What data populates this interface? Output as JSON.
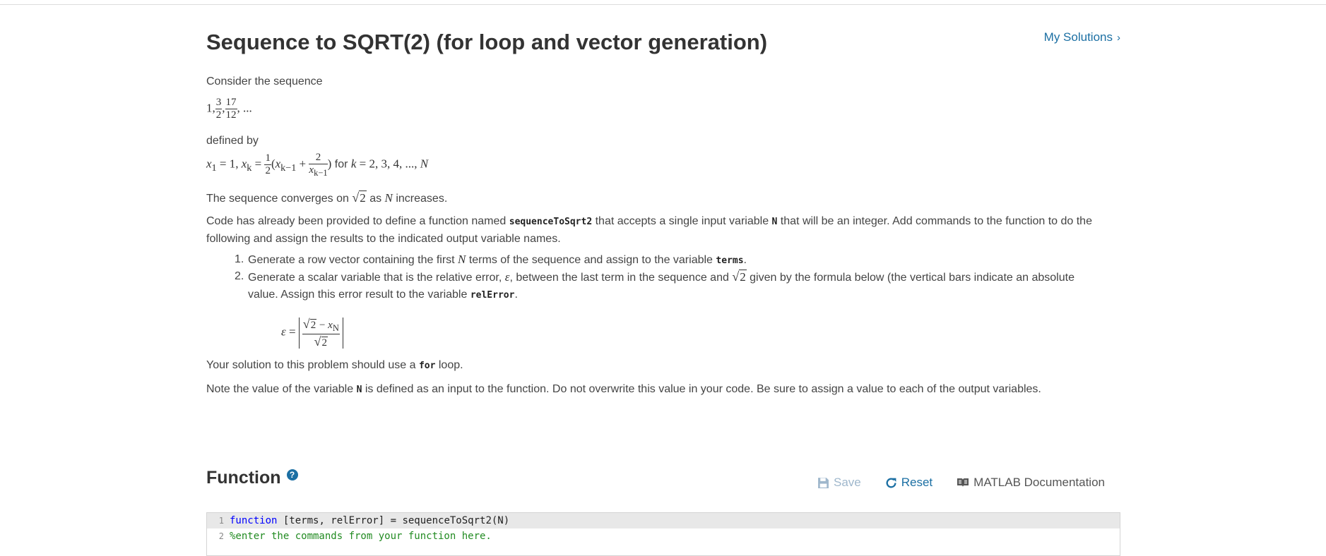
{
  "header": {
    "title": "Sequence to SQRT(2) (for loop and vector generation)",
    "my_solutions": "My Solutions",
    "my_solutions_chevron": "›"
  },
  "problem": {
    "intro": "Consider the sequence",
    "sequence": {
      "first": "1,",
      "f1_num": "3",
      "f1_den": "2",
      "sep": ",",
      "f2_num": "17",
      "f2_den": "12",
      "tail": ", ..."
    },
    "defined_by": "defined by",
    "definition": {
      "lhs": "x",
      "lhs_sub": "1",
      "eq1": " = 1, ",
      "xk": "x",
      "xk_sub": "k",
      "eq2": " = ",
      "half_num": "1",
      "half_den": "2",
      "open": "(",
      "xkm1": "x",
      "xkm1_sub": "k−1",
      "plus": " + ",
      "two_num": "2",
      "two_den_x": "x",
      "two_den_sub": "k−1",
      "close": ")",
      "for_text": " for ",
      "k_var": "k",
      "range": " = 2, 3, 4, ..., ",
      "N": "N"
    },
    "converges_pre": "The sequence converges on ",
    "sqrt_sym": "√",
    "sqrt_val": "2",
    "converges_mid": " as ",
    "converges_N": "N",
    "converges_post": " increases.",
    "code_intro_a": "Code has already been provided to define a function named ",
    "func_name": "sequenceToSqrt2",
    "code_intro_b": " that accepts a single input variable ",
    "input_var": "N",
    "code_intro_c": " that will be an integer.  Add commands to the function to do the following and assign the results to the indicated output variable names.",
    "task1_num": "1.",
    "task1_a": "Generate a row vector containing the first ",
    "task1_N": "N",
    "task1_b": " terms of the sequence and assign to the variable ",
    "task1_var": "terms",
    "task1_c": ".",
    "task2_num": "2.",
    "task2_a": "Generate a scalar variable that is the relative error, ",
    "task2_eps": "ε",
    "task2_b": ", between the last term in the sequence and ",
    "task2_c": " given by the formula below (the vertical bars indicate an absolute value.  Assign this error result to the variable ",
    "task2_var": "relError",
    "task2_d": ".",
    "eps_formula": {
      "eps": "ε",
      "eq": " = ",
      "minus": " − ",
      "xN": "x",
      "xN_sub": "N"
    },
    "loop_a": "Your solution to this problem should use a ",
    "loop_kw": "for",
    "loop_b": " loop.",
    "note_a": "Note the value of the variable ",
    "note_var": "N",
    "note_b": " is defined as an input to the function.  Do not overwrite this value in your code.  Be sure to assign a value to each of the output variables."
  },
  "function_section": {
    "title": "Function",
    "help_icon": "?",
    "save_label": "Save",
    "reset_label": "Reset",
    "doc_label": "MATLAB Documentation",
    "code_lines": [
      {
        "num": "1",
        "kw": "function",
        "rest": " [terms, relError] = sequenceToSqrt2(N)"
      },
      {
        "num": "2",
        "comment": "%enter the commands from your function here."
      }
    ]
  },
  "colors": {
    "link": "#1b6fa3",
    "save_disabled": "#9fb7cc",
    "comment": "#228b22",
    "keyword": "#0000ff"
  }
}
